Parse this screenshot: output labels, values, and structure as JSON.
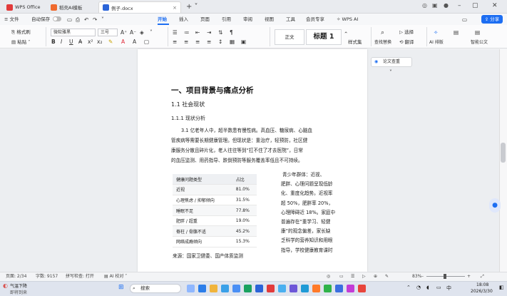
{
  "tabs": {
    "wps_office": "WPS Office",
    "template": "稻壳AI模板",
    "document": "例子.docx"
  },
  "menu": {
    "file": "文件",
    "autosave": "自动保存",
    "items": [
      "开始",
      "插入",
      "页面",
      "引用",
      "审阅",
      "视图",
      "工具",
      "会员专享",
      "WPS AI"
    ],
    "share": "分享"
  },
  "ribbon": {
    "format_painter": "格式刷",
    "paste": "粘贴",
    "font_name": "微软雅黑",
    "font_size": "三号",
    "style_normal": "正文",
    "style_heading1": "标题 1",
    "style_set": "样式集",
    "find_replace": "查找替换",
    "select": "选择",
    "translate": "翻译",
    "ai_layout": "AI 排版",
    "smart_doc": "智能公文"
  },
  "document": {
    "heading1": "一、项目背景与痛点分析",
    "heading2": "1.1 社会现状",
    "heading3": "1.1.1 现状分析",
    "paragraph_lines": [
      "3.1 亿老年人中，超半数患有慢性病。高血压、糖尿病、心脑血",
      "管疾病等需要长期健康管理。但现状是：重治疗，轻预防，社区健",
      "康服务分散且碎片化，老人往往等到“扛不住了才去医院”，日常",
      "的血压监测、用药指导、跌倒预防等服务覆盖率低且不可持续。"
    ],
    "table": {
      "headers": [
        "健康问题类型",
        "占比"
      ],
      "rows": [
        [
          "近视",
          "81.0%"
        ],
        [
          "心理焦虑 / 抑郁倾向",
          "31.5%"
        ],
        [
          "睡眠不足",
          "77.8%"
        ],
        [
          "肥胖 / 超重",
          "19.0%"
        ],
        [
          "脊柱 / 骨骼不适",
          "45.2%"
        ],
        [
          "网络成瘾倾向",
          "15.3%"
        ]
      ]
    },
    "side_text_lines": [
      "青少年群体：近视、",
      "肥胖、心理问题呈现低龄",
      "化、重度化趋势。近视率",
      "超 50%，肥胖率 20%，",
      "心理障碍近 18%。家庭中",
      "普遍存在“重学习、轻健",
      "康”的观念偏差，家长缺",
      "乏科学的营养知识和用眼",
      "指导，学校健康教育课时"
    ],
    "source": "来源：国家卫健委、国产体质监测"
  },
  "side_panel": {
    "label": "论文查重"
  },
  "statusbar": {
    "page": "页面: 2/34",
    "words": "字数: 9157",
    "spell_check": "拼写检查: 打开",
    "ai_check": "AI 校对",
    "zoom": "83%"
  },
  "taskbar": {
    "weather_title": "气温下降",
    "weather_sub": "即将到来",
    "search": "搜索",
    "time": "18:08",
    "date": "2026/3/30"
  },
  "colors": {
    "accent": "#1d6ef2",
    "wps_red": "#e23b3b"
  }
}
